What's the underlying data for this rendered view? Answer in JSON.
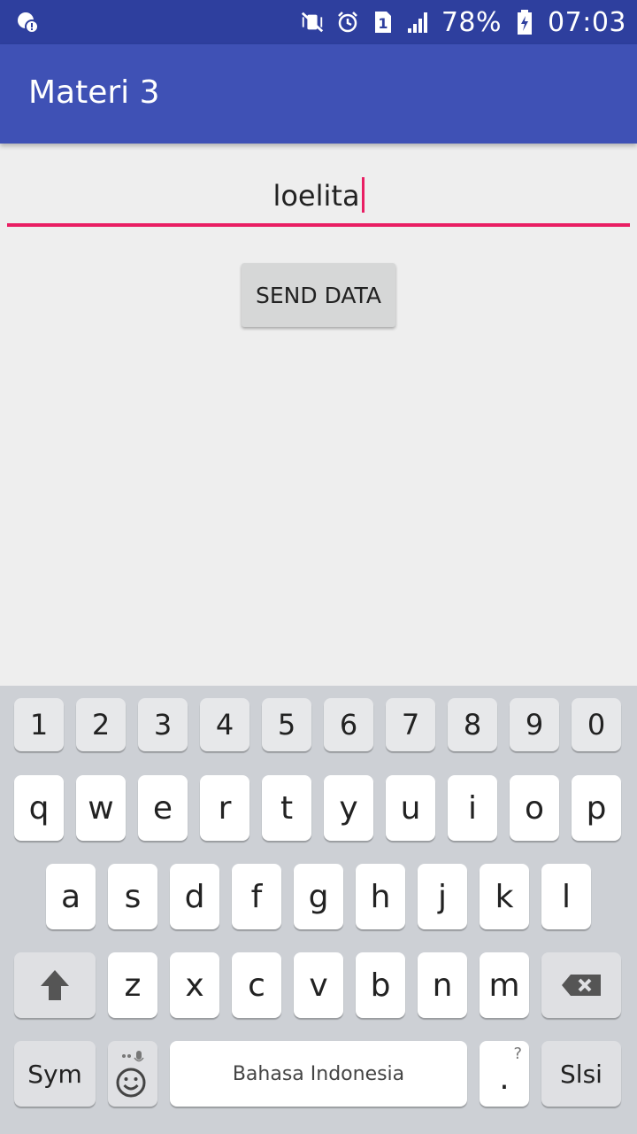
{
  "status_bar": {
    "battery": "78%",
    "time": "07:03",
    "sim_number": "1",
    "icons": [
      "notification-icon",
      "mute-vibrate-icon",
      "alarm-icon",
      "sim-icon",
      "signal-icon",
      "battery-charging-icon"
    ]
  },
  "app_bar": {
    "title": "Materi 3"
  },
  "form": {
    "input_value": "loelita",
    "send_button_label": "SEND DATA"
  },
  "keyboard": {
    "number_row": [
      "1",
      "2",
      "3",
      "4",
      "5",
      "6",
      "7",
      "8",
      "9",
      "0"
    ],
    "row1": [
      "q",
      "w",
      "e",
      "r",
      "t",
      "y",
      "u",
      "i",
      "o",
      "p"
    ],
    "row2": [
      "a",
      "s",
      "d",
      "f",
      "g",
      "h",
      "j",
      "k",
      "l"
    ],
    "row3": [
      "z",
      "x",
      "c",
      "v",
      "b",
      "n",
      "m"
    ],
    "sym_label": "Sym",
    "space_label": "Bahasa Indonesia",
    "period_label": ".",
    "period_hint": "?",
    "enter_label": "Slsi",
    "colors": {
      "accent": "#e91e63",
      "primary": "#3f51b5",
      "status": "#2e3f9e"
    }
  }
}
